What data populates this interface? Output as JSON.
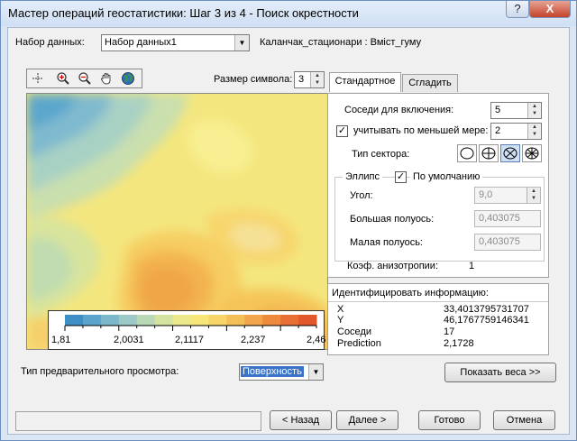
{
  "window": {
    "title": "Мастер операций геостатистики: Шаг 3 из 4 - Поиск окрестности",
    "help_button": "?",
    "close_button": "X"
  },
  "dataset": {
    "label": "Набор данных:",
    "selected": "Набор данных1",
    "info": "Каланчак_стационари : Вміст_гуму"
  },
  "toolbar": {
    "tools": [
      "cross-icon",
      "zoom-in-icon",
      "zoom-out-icon",
      "pan-hand-icon",
      "globe-icon"
    ]
  },
  "symbol_size": {
    "label": "Размер символа:",
    "value": "3"
  },
  "tabs": [
    {
      "label": "Стандартное",
      "active": true
    },
    {
      "label": "Сгладить",
      "active": false
    }
  ],
  "standard": {
    "neighbors_label": "Соседи для включения:",
    "neighbors_value": "5",
    "at_least_label": "учитывать по меньшей мере:",
    "at_least_value": "2",
    "at_least_checked": true,
    "sector_type_label": "Тип сектора:",
    "ellipse_group_label": "Эллипс",
    "default_label": "По умолчанию",
    "default_checked": true,
    "angle_label": "Угол:",
    "angle_value": "9,0",
    "major_label": "Большая полуось:",
    "major_value": "0,403075",
    "minor_label": "Малая полуось:",
    "minor_value": "0,403075",
    "anisotropy_label": "Коэф. анизотропии:",
    "anisotropy_value": "1"
  },
  "identify": {
    "title": "Идентифицировать информацию:",
    "rows": [
      {
        "key": "X",
        "value": "33,4013795731707"
      },
      {
        "key": "Y",
        "value": "46,1767759146341"
      },
      {
        "key": "Соседи",
        "value": "17"
      },
      {
        "key": "Prediction",
        "value": "2,1728"
      }
    ]
  },
  "legend": {
    "ticks": [
      "1,81",
      "2,0031",
      "2,1117",
      "2,237",
      "2,46"
    ],
    "colors": [
      "#3d8fc6",
      "#5aa3cb",
      "#7cb8cc",
      "#9ccbc7",
      "#b9d8b6",
      "#d5e3a0",
      "#ece98b",
      "#f7e678",
      "#f8d568",
      "#f5bf58",
      "#f2a54a",
      "#ee8a3d",
      "#e86e33",
      "#e2582c"
    ]
  },
  "preview_type": {
    "label": "Тип предварительного просмотра:",
    "selected": "Поверхность"
  },
  "buttons": {
    "show_weights": "Показать веса >>",
    "back": "< Назад",
    "next": "Далее >",
    "finish": "Готово",
    "cancel": "Отмена"
  },
  "status_text": ""
}
